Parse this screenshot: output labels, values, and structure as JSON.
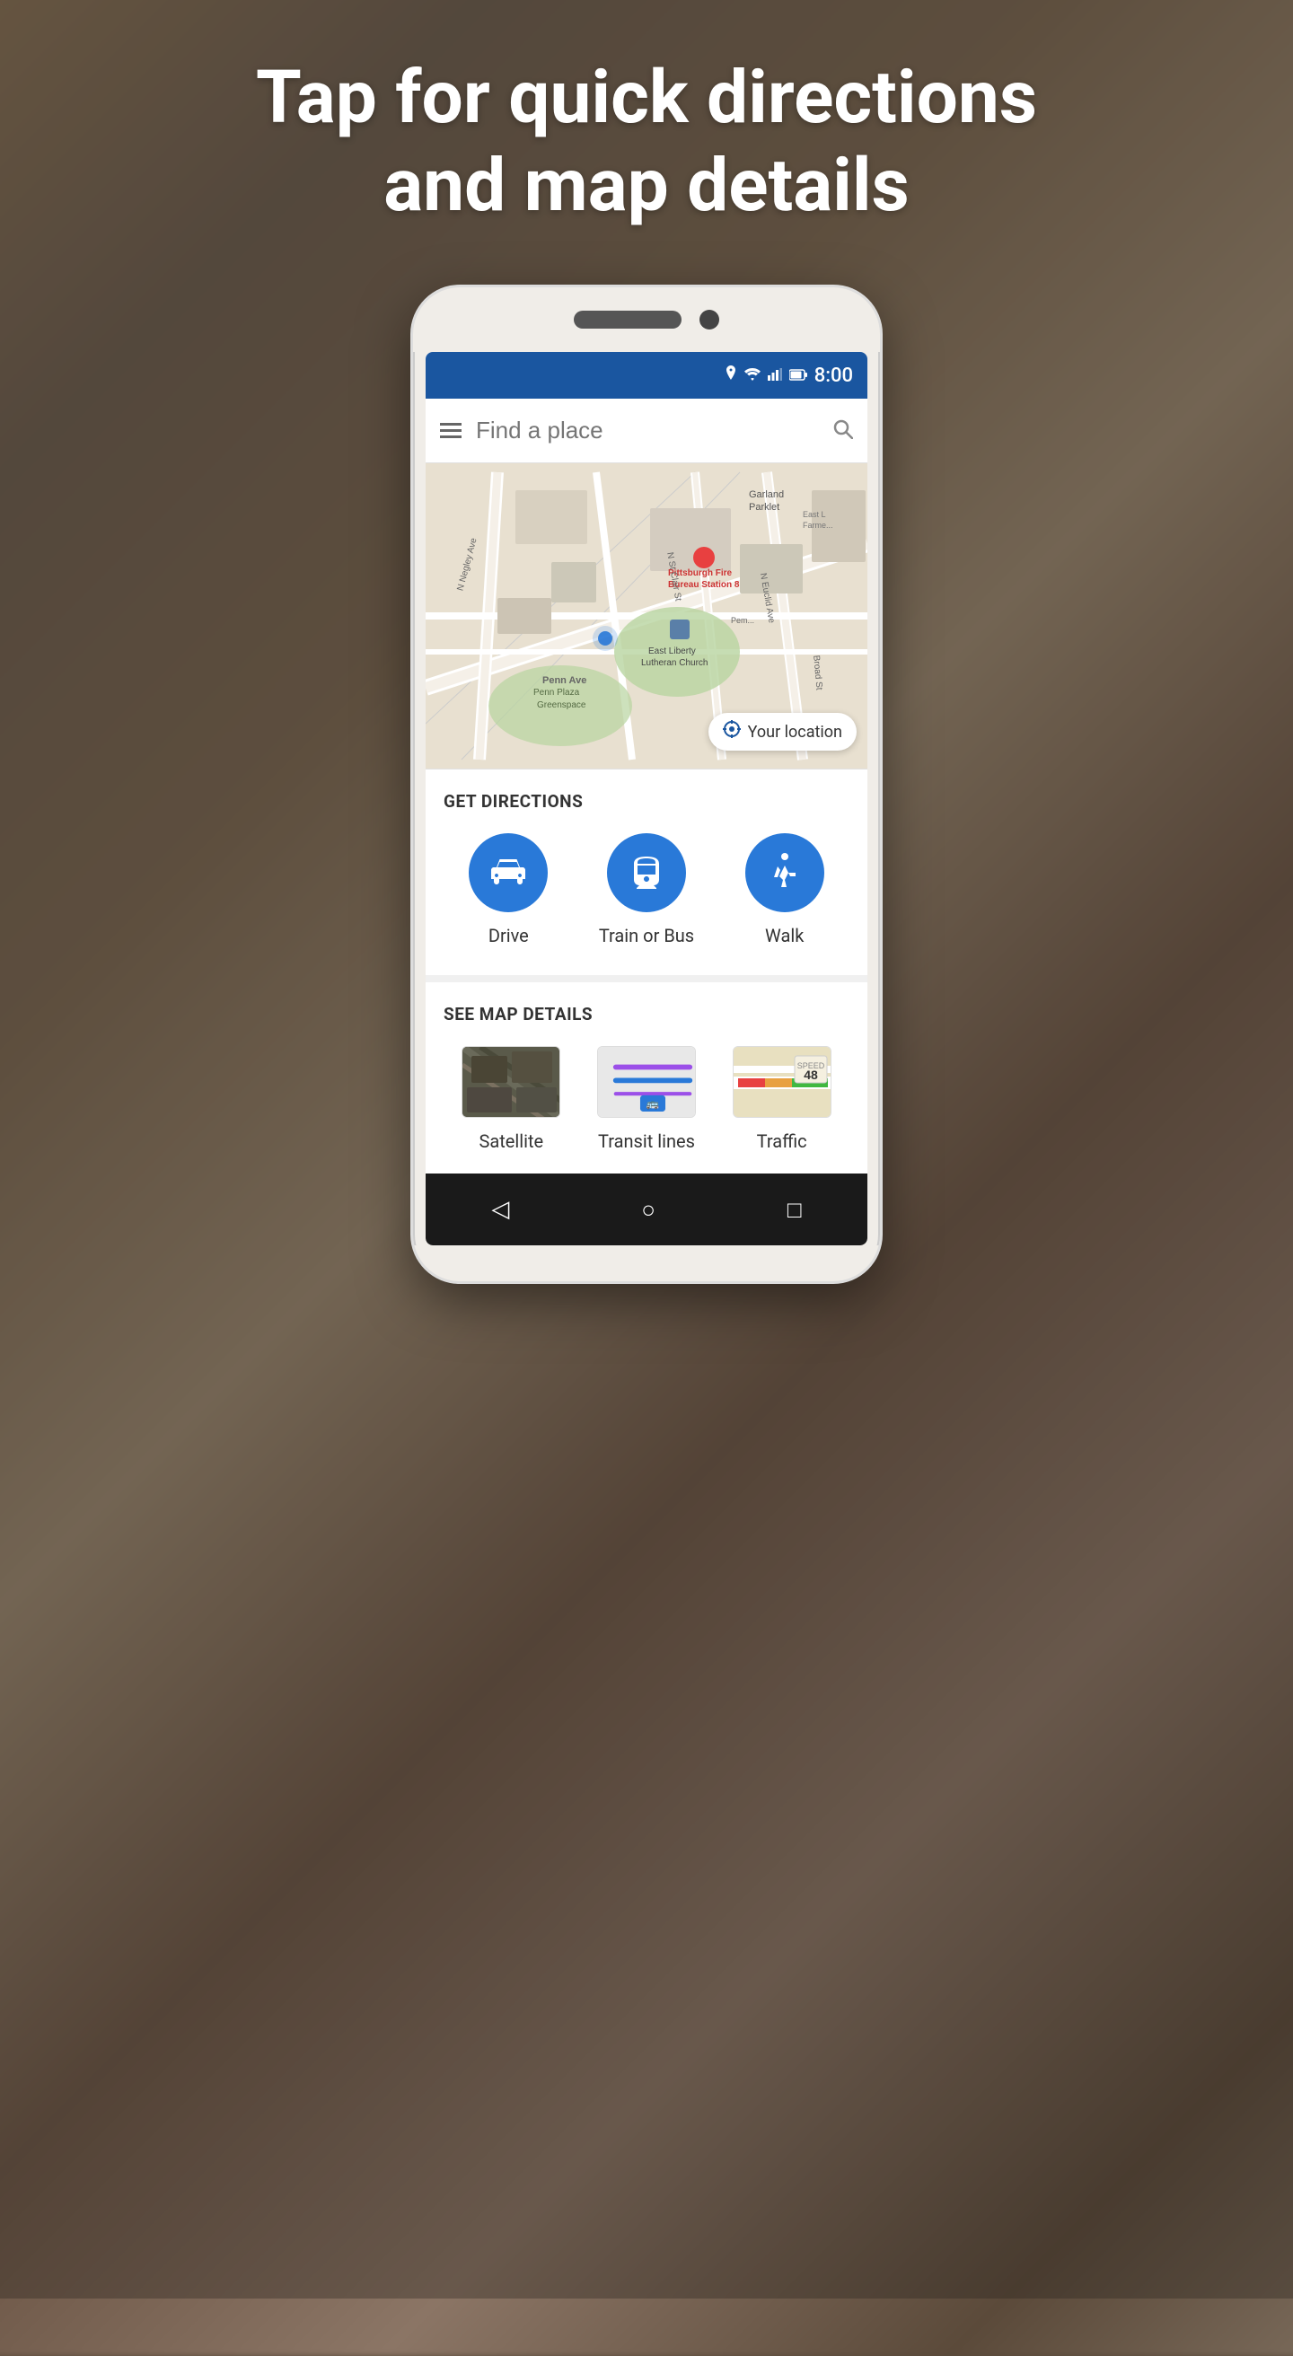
{
  "headline": {
    "line1": "Tap for quick directions",
    "line2": "and map details"
  },
  "status_bar": {
    "time": "8:00",
    "icons": [
      "location",
      "wifi",
      "signal",
      "battery"
    ]
  },
  "search": {
    "placeholder": "Find a place",
    "menu_icon": "☰",
    "search_icon": "🔍"
  },
  "map": {
    "your_location_label": "Your location",
    "places": [
      "Garland Parklet",
      "Pittsburgh Fire Bureau Station 8",
      "East Liberty Lutheran Church",
      "Penn Plaza Greenspace",
      "East Liberty Farmers Market"
    ],
    "streets": [
      "N Negley Ave",
      "Penn Ave",
      "Broad St",
      "N Euclid Ave",
      "N St Clair St",
      "Perm Ave"
    ]
  },
  "directions": {
    "section_title": "GET DIRECTIONS",
    "items": [
      {
        "label": "Drive",
        "icon": "car"
      },
      {
        "label": "Train or Bus",
        "icon": "train"
      },
      {
        "label": "Walk",
        "icon": "walk"
      }
    ]
  },
  "map_details": {
    "section_title": "SEE MAP DETAILS",
    "items": [
      {
        "label": "Satellite"
      },
      {
        "label": "Transit lines"
      },
      {
        "label": "Traffic"
      }
    ]
  },
  "nav_bar": {
    "back": "◁",
    "home": "○",
    "recent": "□"
  },
  "colors": {
    "accent_blue": "#2979d8",
    "status_bar": "#1a56a0",
    "dark_nav": "#1a1a1a"
  }
}
